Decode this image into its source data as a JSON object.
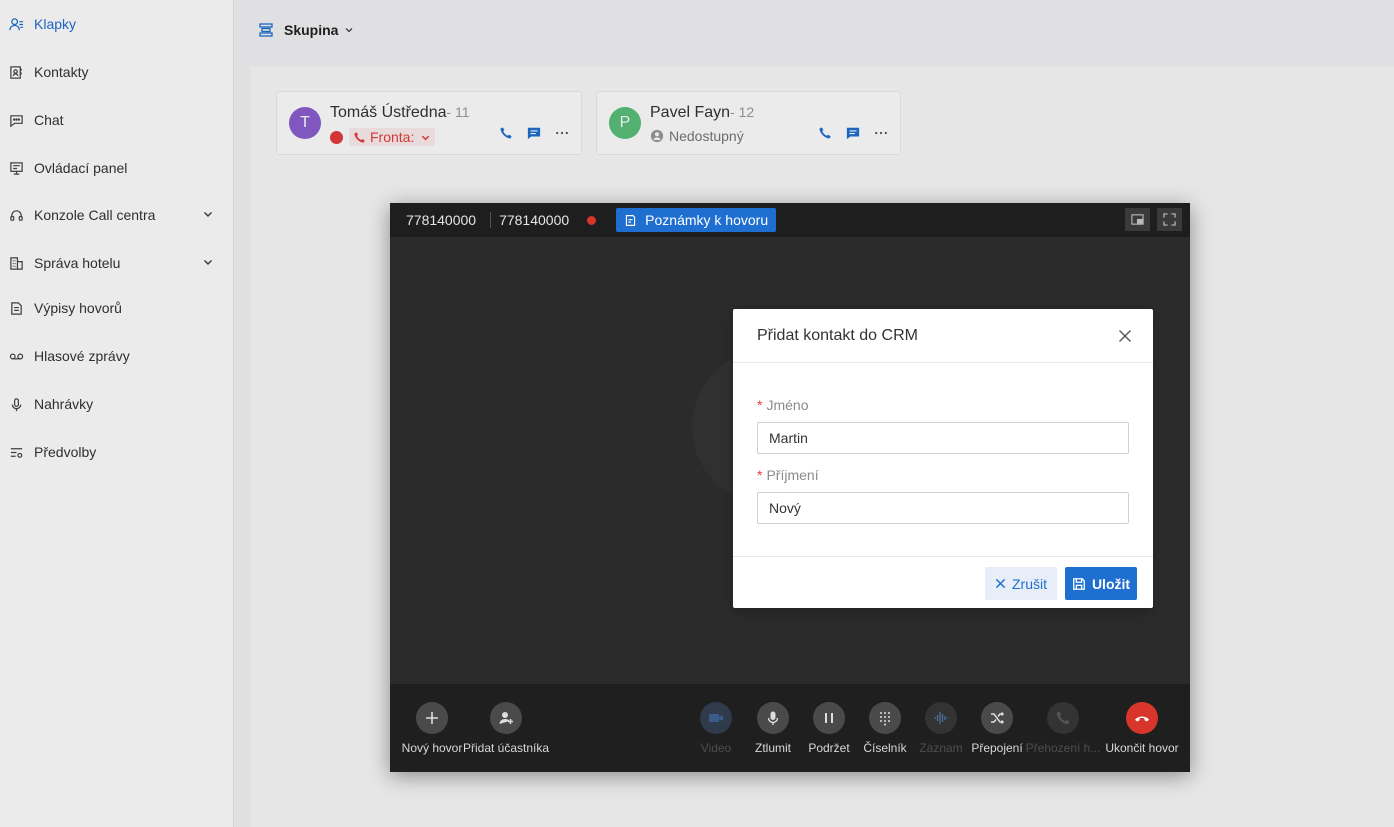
{
  "sidebar": {
    "items": [
      {
        "label": "Klapky",
        "icon": "user-list-icon",
        "active": true
      },
      {
        "label": "Kontakty",
        "icon": "contacts-book-icon"
      },
      {
        "label": "Chat",
        "icon": "chat-bubble-icon"
      },
      {
        "label": "Ovládací panel",
        "icon": "dashboard-panel-icon"
      },
      {
        "label": "Konzole Call centra",
        "icon": "headset-icon",
        "expandable": true
      },
      {
        "label": "Správa hotelu",
        "icon": "building-icon",
        "expandable": true
      },
      {
        "label": "Výpisy hovorů",
        "icon": "call-log-icon"
      },
      {
        "label": "Hlasové zprávy",
        "icon": "voicemail-icon"
      },
      {
        "label": "Nahrávky",
        "icon": "microphone-icon"
      },
      {
        "label": "Předvolby",
        "icon": "preferences-icon"
      }
    ]
  },
  "header": {
    "group_label": "Skupina"
  },
  "extensions": [
    {
      "initial": "T",
      "name": "Tomáš Ústředna",
      "ext": "- 11",
      "status": "Fronta:",
      "avatar_color": "#8a5fd0"
    },
    {
      "initial": "P",
      "name": "Pavel Fayn",
      "ext": "- 12",
      "status": "Nedostupný",
      "avatar_color": "#59c07a"
    }
  ],
  "call": {
    "number_a": "778140000",
    "number_b": "778140000",
    "notes_label": "Poznámky k hovoru",
    "controls": [
      {
        "label": "Nový hovor",
        "icon": "plus-icon"
      },
      {
        "label": "Přidat účastníka",
        "icon": "add-participant-icon"
      },
      {
        "label": "Video",
        "icon": "video-icon",
        "disabled": true
      },
      {
        "label": "Ztlumit",
        "icon": "microphone-icon"
      },
      {
        "label": "Podržet",
        "icon": "pause-icon"
      },
      {
        "label": "Číselník",
        "icon": "dialpad-icon"
      },
      {
        "label": "Záznam",
        "icon": "waveform-icon",
        "disabled": true
      },
      {
        "label": "Přepojení",
        "icon": "transfer-icon"
      },
      {
        "label": "Přehození h...",
        "icon": "swap-call-icon",
        "disabled": true
      },
      {
        "label": "Ukončit hovor",
        "icon": "hangup-icon"
      }
    ]
  },
  "modal": {
    "title": "Přidat kontakt do CRM",
    "first_name_label": "Jméno",
    "first_name_value": "Martin",
    "last_name_label": "Příjmení",
    "last_name_value": "Nový",
    "cancel_label": "Zrušit",
    "save_label": "Uložit"
  }
}
